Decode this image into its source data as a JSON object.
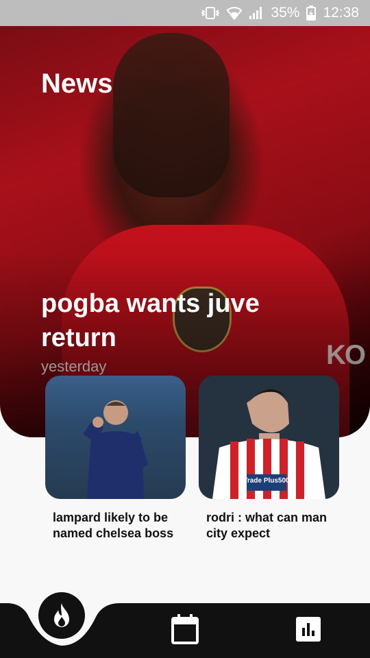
{
  "status_bar": {
    "battery": "35%",
    "time": "12:38",
    "icons": [
      "vibrate-icon",
      "wifi-icon",
      "signal-icon",
      "battery-charging-icon"
    ]
  },
  "hero": {
    "section_title": "News",
    "headline": "pogba wants juve return",
    "timestamp": "yesterday",
    "sponsor_text": "KO"
  },
  "cards": [
    {
      "title": "lampard likely to be named chelsea boss"
    },
    {
      "title": "rodri : what can man city expect",
      "shirt_text": "Trade Plus500"
    }
  ],
  "bottom_nav": {
    "items": [
      {
        "icon": "flame-icon",
        "active": true
      },
      {
        "icon": "calendar-icon",
        "active": false
      },
      {
        "icon": "bar-chart-icon",
        "active": false
      }
    ]
  },
  "colors": {
    "hero_red": "#a8101a",
    "nav_black": "#111111",
    "background": "#f8f8f8"
  }
}
